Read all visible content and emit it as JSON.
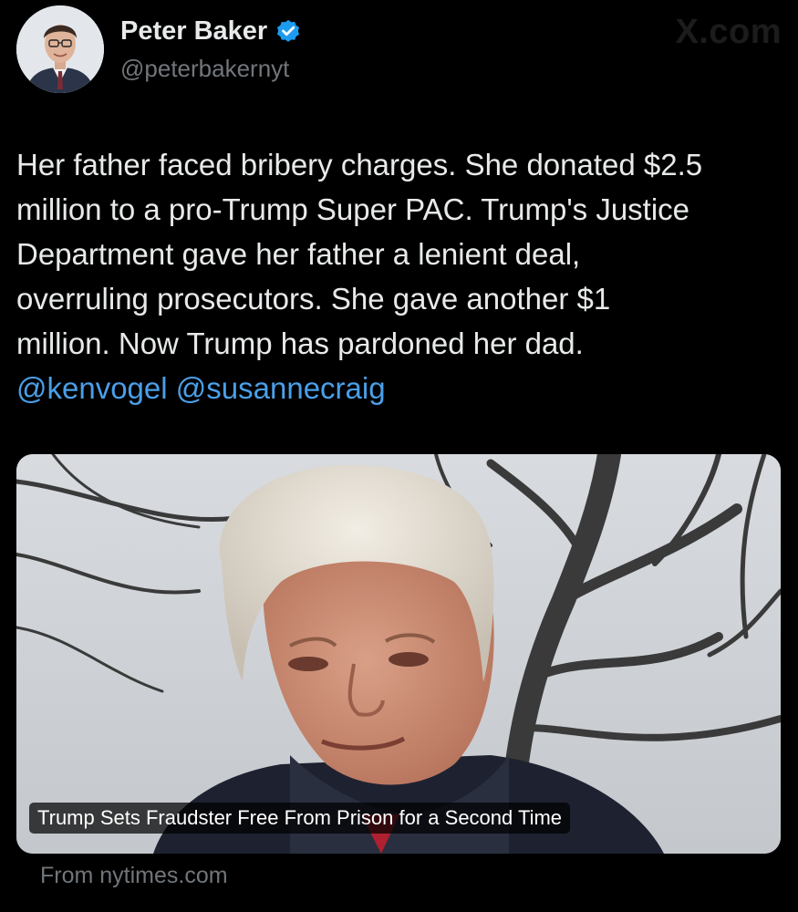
{
  "author": {
    "name": "Peter Baker",
    "handle": "@peterbakernyt",
    "verified": true
  },
  "watermark": "X.com",
  "tweet": {
    "lines": [
      "Her father faced bribery charges. She donated $2.5",
      "million to a pro-Trump Super PAC. Trump's Justice",
      "Department gave her father a lenient deal,",
      "overruling prosecutors. She gave another $1",
      "million. Now Trump has pardoned her dad."
    ],
    "mentions": [
      "@kenvogel",
      "@susannecraig"
    ]
  },
  "link_card": {
    "caption": "Trump Sets Fraudster Free From Prison for a Second Time",
    "source": "From nytimes.com"
  },
  "colors": {
    "background": "#000000",
    "text": "#e7e9ea",
    "secondary": "#71767b",
    "link": "#4a9fe8",
    "verified_badge": "#1d9bf0"
  }
}
